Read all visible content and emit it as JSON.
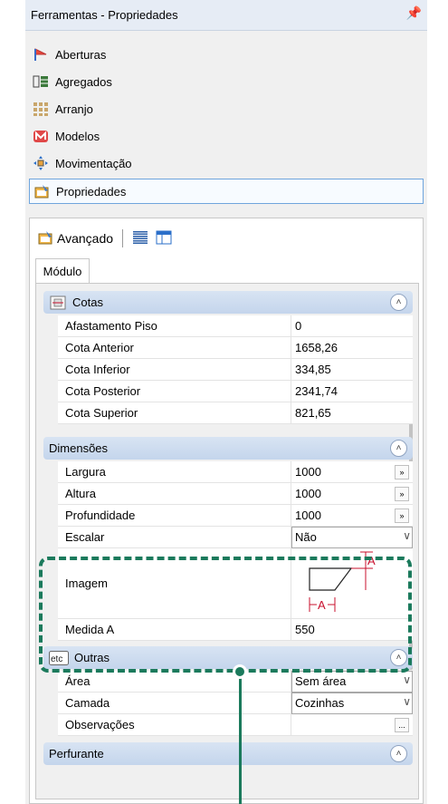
{
  "window": {
    "title": "Ferramentas - Propriedades",
    "pin_glyph": "⮙"
  },
  "menu": [
    {
      "label": "Aberturas",
      "icon": "aberturas-icon"
    },
    {
      "label": "Agregados",
      "icon": "agregados-icon"
    },
    {
      "label": "Arranjo",
      "icon": "arranjo-icon"
    },
    {
      "label": "Modelos",
      "icon": "modelos-icon"
    },
    {
      "label": "Movimentação",
      "icon": "movimentacao-icon"
    },
    {
      "label": "Propriedades",
      "icon": "propriedades-icon",
      "selected": true
    }
  ],
  "toolbar": {
    "label": "Avançado"
  },
  "tab": {
    "label": "Módulo"
  },
  "sections": {
    "cotas": {
      "title": "Cotas",
      "rows": [
        {
          "name": "Afastamento Piso",
          "value": "0"
        },
        {
          "name": "Cota Anterior",
          "value": "1658,26"
        },
        {
          "name": "Cota Inferior",
          "value": "334,85"
        },
        {
          "name": "Cota Posterior",
          "value": "2341,74"
        },
        {
          "name": "Cota Superior",
          "value": "821,65"
        }
      ]
    },
    "dimensoes": {
      "title": "Dimensões",
      "rows": [
        {
          "name": "Largura",
          "value": "1000"
        },
        {
          "name": "Altura",
          "value": "1000"
        },
        {
          "name": "Profundidade",
          "value": "1000"
        },
        {
          "name": "Escalar",
          "value": "Não"
        },
        {
          "name": "Imagem",
          "value": ""
        },
        {
          "name": "Medida A",
          "value": "550"
        }
      ],
      "image_label": "A"
    },
    "outras": {
      "title": "Outras",
      "icon_text": "etc",
      "rows": [
        {
          "name": "Área",
          "value": "Sem área"
        },
        {
          "name": "Camada",
          "value": "Cozinhas"
        },
        {
          "name": "Observações",
          "value": ""
        }
      ]
    },
    "perfurante": {
      "title": "Perfurante"
    }
  },
  "buttons": {
    "ellipsis": "»",
    "dots": "...",
    "collapse": "˄",
    "dropdown": "∨"
  },
  "colors": {
    "highlight": "#1b7a5c",
    "accent_red": "#c8102e",
    "selected_border": "#6fa5dd"
  }
}
